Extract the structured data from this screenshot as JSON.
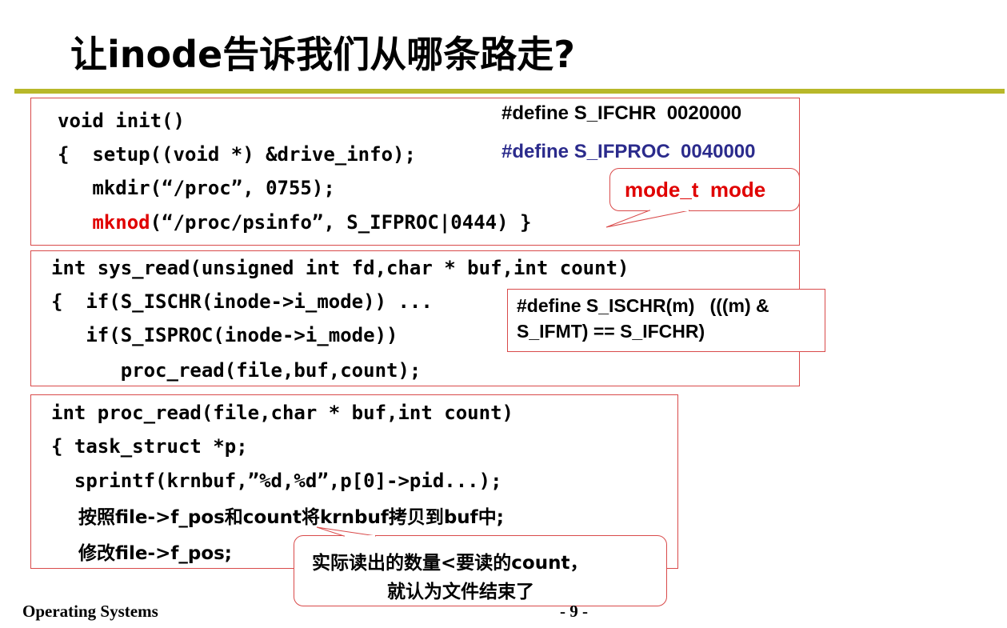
{
  "slide": {
    "title": "让inode告诉我们从哪条路走?",
    "footer_left": "Operating Systems",
    "footer_right": "- 9 -"
  },
  "box1": {
    "line1": "void init()",
    "line2": "{  setup((void *) &drive_info);",
    "line3": "   mkdir(“/proc”, 0755);",
    "line4_fn": "mknod",
    "line4_rest": "(“/proc/psinfo”, S_IFPROC|0444)",
    "line4_brace": "}",
    "define1": "#define S_IFCHR  0020000",
    "define2": "#define S_IFPROC  0040000",
    "callout": "mode_t  mode"
  },
  "box2": {
    "line1": "int sys_read(unsigned int fd,char * buf,int count)",
    "line2": "{  if(S_ISCHR(inode->i_mode)) ...",
    "line3": "   if(S_ISPROC(inode->i_mode))",
    "line4": "      proc_read(file,buf,count);",
    "note_line1": "#define S_ISCHR(m)   (((m) &",
    "note_line2": "S_IFMT) == S_IFCHR)"
  },
  "box3": {
    "line1": "int proc_read(file,char * buf,int count)",
    "line2": "{ task_struct *p;",
    "line3": "  sprintf(krnbuf,”%d,%d”,p[0]->pid...);",
    "line4": "按照file->f_pos和count将krnbuf拷贝到buf中;",
    "line5": "修改file->f_pos;",
    "callout_line1": "实际读出的数量<要读的count，",
    "callout_line2": "就认为文件结束了"
  },
  "colors": {
    "accent_rule": "#b8b82a",
    "border_red": "#d94a4a",
    "highlight_red": "#e00000",
    "define_blue": "#2b2b8c"
  }
}
